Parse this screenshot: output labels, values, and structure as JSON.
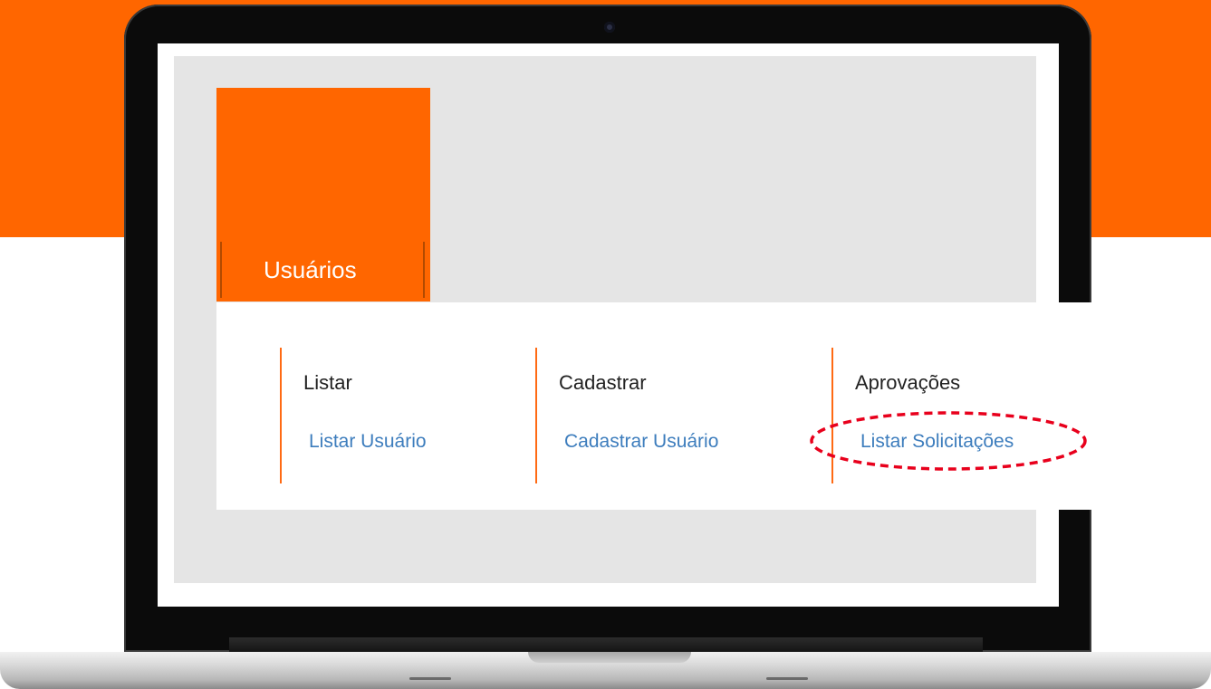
{
  "tile": {
    "label": "Usuários",
    "color": "#ff6600"
  },
  "menu": {
    "columns": [
      {
        "heading": "Listar",
        "link": "Listar Usuário"
      },
      {
        "heading": "Cadastrar",
        "link": "Cadastrar Usuário"
      },
      {
        "heading": "Aprovações",
        "link": "Listar Solicitações"
      }
    ]
  },
  "colors": {
    "brand_orange": "#ff6600",
    "link_blue": "#3d7dbd",
    "divider_orange": "#ff6a13",
    "highlight_red": "#e8001c",
    "panel_gray": "#e5e5e5"
  }
}
